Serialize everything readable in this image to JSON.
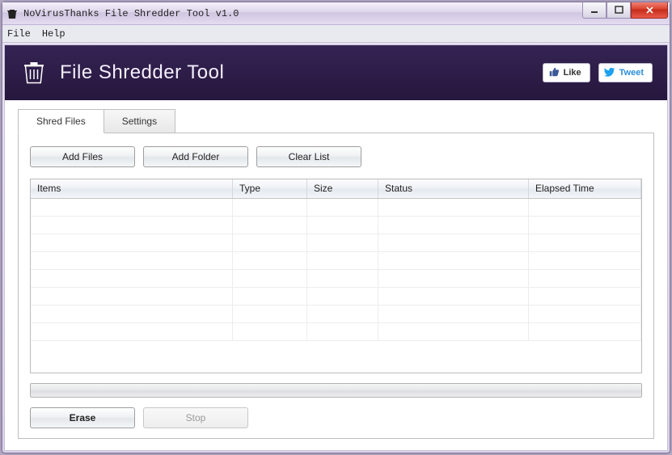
{
  "window": {
    "title": "NoVirusThanks File Shredder Tool v1.0"
  },
  "menubar": {
    "file": "File",
    "help": "Help"
  },
  "hero": {
    "title": "File Shredder Tool",
    "like": "Like",
    "tweet": "Tweet"
  },
  "tabs": {
    "shred": "Shred Files",
    "settings": "Settings"
  },
  "buttons": {
    "add_files": "Add Files",
    "add_folder": "Add Folder",
    "clear_list": "Clear List",
    "erase": "Erase",
    "stop": "Stop"
  },
  "columns": {
    "items": "Items",
    "type": "Type",
    "size": "Size",
    "status": "Status",
    "elapsed": "Elapsed Time"
  }
}
